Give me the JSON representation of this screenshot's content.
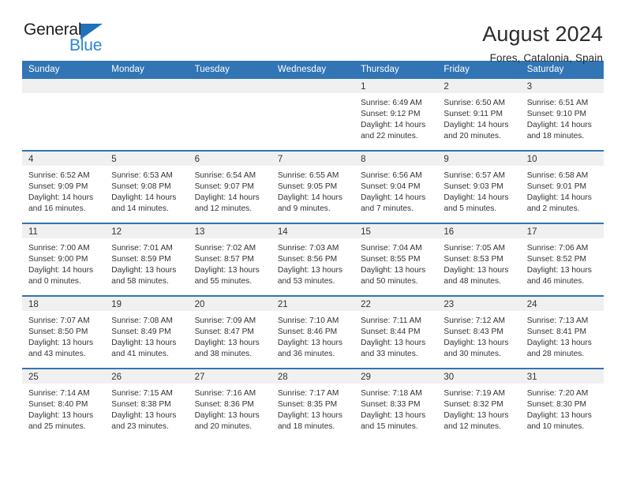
{
  "logo": {
    "word_general": "General",
    "word_blue": "Blue",
    "triangle_color": "#1f72b8"
  },
  "header": {
    "month_title": "August 2024",
    "location": "Fores, Catalonia, Spain"
  },
  "theme": {
    "header_blue": "#3175b5",
    "daynum_band": "#f0f0f0",
    "text": "#333333"
  },
  "weekdays": [
    "Sunday",
    "Monday",
    "Tuesday",
    "Wednesday",
    "Thursday",
    "Friday",
    "Saturday"
  ],
  "weeks": [
    [
      {
        "day": "",
        "empty": true
      },
      {
        "day": "",
        "empty": true
      },
      {
        "day": "",
        "empty": true
      },
      {
        "day": "",
        "empty": true
      },
      {
        "day": "1",
        "sunrise": "Sunrise: 6:49 AM",
        "sunset": "Sunset: 9:12 PM",
        "daylight_line1": "Daylight: 14 hours",
        "daylight_line2": "and 22 minutes."
      },
      {
        "day": "2",
        "sunrise": "Sunrise: 6:50 AM",
        "sunset": "Sunset: 9:11 PM",
        "daylight_line1": "Daylight: 14 hours",
        "daylight_line2": "and 20 minutes."
      },
      {
        "day": "3",
        "sunrise": "Sunrise: 6:51 AM",
        "sunset": "Sunset: 9:10 PM",
        "daylight_line1": "Daylight: 14 hours",
        "daylight_line2": "and 18 minutes."
      }
    ],
    [
      {
        "day": "4",
        "sunrise": "Sunrise: 6:52 AM",
        "sunset": "Sunset: 9:09 PM",
        "daylight_line1": "Daylight: 14 hours",
        "daylight_line2": "and 16 minutes."
      },
      {
        "day": "5",
        "sunrise": "Sunrise: 6:53 AM",
        "sunset": "Sunset: 9:08 PM",
        "daylight_line1": "Daylight: 14 hours",
        "daylight_line2": "and 14 minutes."
      },
      {
        "day": "6",
        "sunrise": "Sunrise: 6:54 AM",
        "sunset": "Sunset: 9:07 PM",
        "daylight_line1": "Daylight: 14 hours",
        "daylight_line2": "and 12 minutes."
      },
      {
        "day": "7",
        "sunrise": "Sunrise: 6:55 AM",
        "sunset": "Sunset: 9:05 PM",
        "daylight_line1": "Daylight: 14 hours",
        "daylight_line2": "and 9 minutes."
      },
      {
        "day": "8",
        "sunrise": "Sunrise: 6:56 AM",
        "sunset": "Sunset: 9:04 PM",
        "daylight_line1": "Daylight: 14 hours",
        "daylight_line2": "and 7 minutes."
      },
      {
        "day": "9",
        "sunrise": "Sunrise: 6:57 AM",
        "sunset": "Sunset: 9:03 PM",
        "daylight_line1": "Daylight: 14 hours",
        "daylight_line2": "and 5 minutes."
      },
      {
        "day": "10",
        "sunrise": "Sunrise: 6:58 AM",
        "sunset": "Sunset: 9:01 PM",
        "daylight_line1": "Daylight: 14 hours",
        "daylight_line2": "and 2 minutes."
      }
    ],
    [
      {
        "day": "11",
        "sunrise": "Sunrise: 7:00 AM",
        "sunset": "Sunset: 9:00 PM",
        "daylight_line1": "Daylight: 14 hours",
        "daylight_line2": "and 0 minutes."
      },
      {
        "day": "12",
        "sunrise": "Sunrise: 7:01 AM",
        "sunset": "Sunset: 8:59 PM",
        "daylight_line1": "Daylight: 13 hours",
        "daylight_line2": "and 58 minutes."
      },
      {
        "day": "13",
        "sunrise": "Sunrise: 7:02 AM",
        "sunset": "Sunset: 8:57 PM",
        "daylight_line1": "Daylight: 13 hours",
        "daylight_line2": "and 55 minutes."
      },
      {
        "day": "14",
        "sunrise": "Sunrise: 7:03 AM",
        "sunset": "Sunset: 8:56 PM",
        "daylight_line1": "Daylight: 13 hours",
        "daylight_line2": "and 53 minutes."
      },
      {
        "day": "15",
        "sunrise": "Sunrise: 7:04 AM",
        "sunset": "Sunset: 8:55 PM",
        "daylight_line1": "Daylight: 13 hours",
        "daylight_line2": "and 50 minutes."
      },
      {
        "day": "16",
        "sunrise": "Sunrise: 7:05 AM",
        "sunset": "Sunset: 8:53 PM",
        "daylight_line1": "Daylight: 13 hours",
        "daylight_line2": "and 48 minutes."
      },
      {
        "day": "17",
        "sunrise": "Sunrise: 7:06 AM",
        "sunset": "Sunset: 8:52 PM",
        "daylight_line1": "Daylight: 13 hours",
        "daylight_line2": "and 46 minutes."
      }
    ],
    [
      {
        "day": "18",
        "sunrise": "Sunrise: 7:07 AM",
        "sunset": "Sunset: 8:50 PM",
        "daylight_line1": "Daylight: 13 hours",
        "daylight_line2": "and 43 minutes."
      },
      {
        "day": "19",
        "sunrise": "Sunrise: 7:08 AM",
        "sunset": "Sunset: 8:49 PM",
        "daylight_line1": "Daylight: 13 hours",
        "daylight_line2": "and 41 minutes."
      },
      {
        "day": "20",
        "sunrise": "Sunrise: 7:09 AM",
        "sunset": "Sunset: 8:47 PM",
        "daylight_line1": "Daylight: 13 hours",
        "daylight_line2": "and 38 minutes."
      },
      {
        "day": "21",
        "sunrise": "Sunrise: 7:10 AM",
        "sunset": "Sunset: 8:46 PM",
        "daylight_line1": "Daylight: 13 hours",
        "daylight_line2": "and 36 minutes."
      },
      {
        "day": "22",
        "sunrise": "Sunrise: 7:11 AM",
        "sunset": "Sunset: 8:44 PM",
        "daylight_line1": "Daylight: 13 hours",
        "daylight_line2": "and 33 minutes."
      },
      {
        "day": "23",
        "sunrise": "Sunrise: 7:12 AM",
        "sunset": "Sunset: 8:43 PM",
        "daylight_line1": "Daylight: 13 hours",
        "daylight_line2": "and 30 minutes."
      },
      {
        "day": "24",
        "sunrise": "Sunrise: 7:13 AM",
        "sunset": "Sunset: 8:41 PM",
        "daylight_line1": "Daylight: 13 hours",
        "daylight_line2": "and 28 minutes."
      }
    ],
    [
      {
        "day": "25",
        "sunrise": "Sunrise: 7:14 AM",
        "sunset": "Sunset: 8:40 PM",
        "daylight_line1": "Daylight: 13 hours",
        "daylight_line2": "and 25 minutes."
      },
      {
        "day": "26",
        "sunrise": "Sunrise: 7:15 AM",
        "sunset": "Sunset: 8:38 PM",
        "daylight_line1": "Daylight: 13 hours",
        "daylight_line2": "and 23 minutes."
      },
      {
        "day": "27",
        "sunrise": "Sunrise: 7:16 AM",
        "sunset": "Sunset: 8:36 PM",
        "daylight_line1": "Daylight: 13 hours",
        "daylight_line2": "and 20 minutes."
      },
      {
        "day": "28",
        "sunrise": "Sunrise: 7:17 AM",
        "sunset": "Sunset: 8:35 PM",
        "daylight_line1": "Daylight: 13 hours",
        "daylight_line2": "and 18 minutes."
      },
      {
        "day": "29",
        "sunrise": "Sunrise: 7:18 AM",
        "sunset": "Sunset: 8:33 PM",
        "daylight_line1": "Daylight: 13 hours",
        "daylight_line2": "and 15 minutes."
      },
      {
        "day": "30",
        "sunrise": "Sunrise: 7:19 AM",
        "sunset": "Sunset: 8:32 PM",
        "daylight_line1": "Daylight: 13 hours",
        "daylight_line2": "and 12 minutes."
      },
      {
        "day": "31",
        "sunrise": "Sunrise: 7:20 AM",
        "sunset": "Sunset: 8:30 PM",
        "daylight_line1": "Daylight: 13 hours",
        "daylight_line2": "and 10 minutes."
      }
    ]
  ]
}
